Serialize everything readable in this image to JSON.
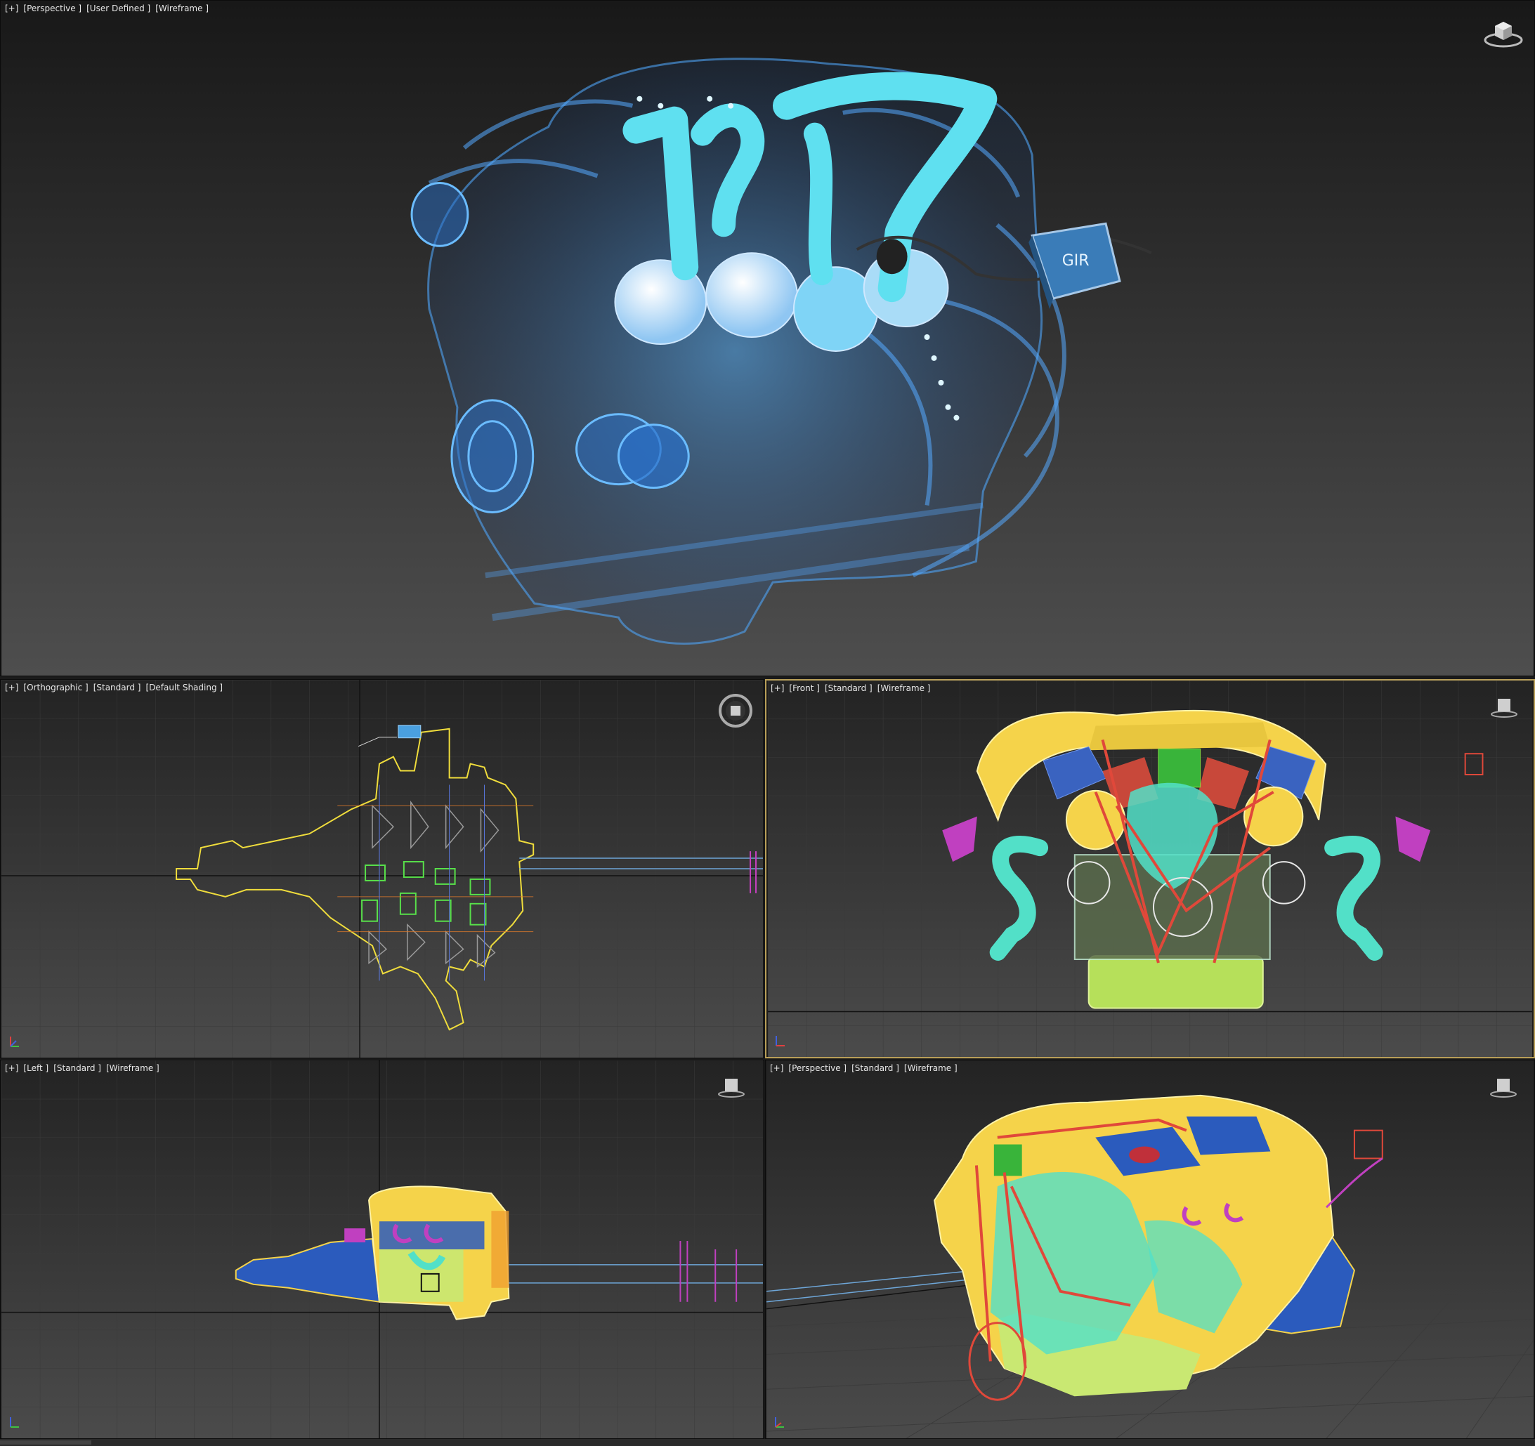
{
  "viewports": {
    "top": {
      "labels": [
        "[+]",
        "[Perspective ]",
        "[User Defined ]",
        "[Wireframe ]"
      ]
    },
    "ortho": {
      "labels": [
        "[+]",
        "[Orthographic ]",
        "[Standard ]",
        "[Default Shading ]"
      ]
    },
    "front": {
      "labels": [
        "[+]",
        "[Front ]",
        "[Standard ]",
        "[Wireframe ]"
      ]
    },
    "left": {
      "labels": [
        "[+]",
        "[Left ]",
        "[Standard ]",
        "[Wireframe ]"
      ]
    },
    "persp": {
      "labels": [
        "[+]",
        "[Perspective ]",
        "[Standard ]",
        "[Wireframe ]"
      ]
    }
  },
  "ecu_logo": "GIR",
  "icons": [
    "viewcube-icon",
    "steering-wheel-icon",
    "axis-tripod-icon"
  ],
  "colors": {
    "viewport_bg_top": "#1e1e1e",
    "viewport_bg_bottom": "#4a4a4a",
    "grid": "#3c3c3c",
    "active_border": "#b99f58",
    "engine_blue": "#2f7fd6",
    "particles": "#5fe0f0",
    "wire_yellow": "#f5d34a",
    "wire_cyan": "#52e0c8",
    "wire_red": "#e0483a",
    "wire_green": "#7fe040",
    "wire_magenta": "#c040c0",
    "wire_blue": "#2b5bbd"
  }
}
